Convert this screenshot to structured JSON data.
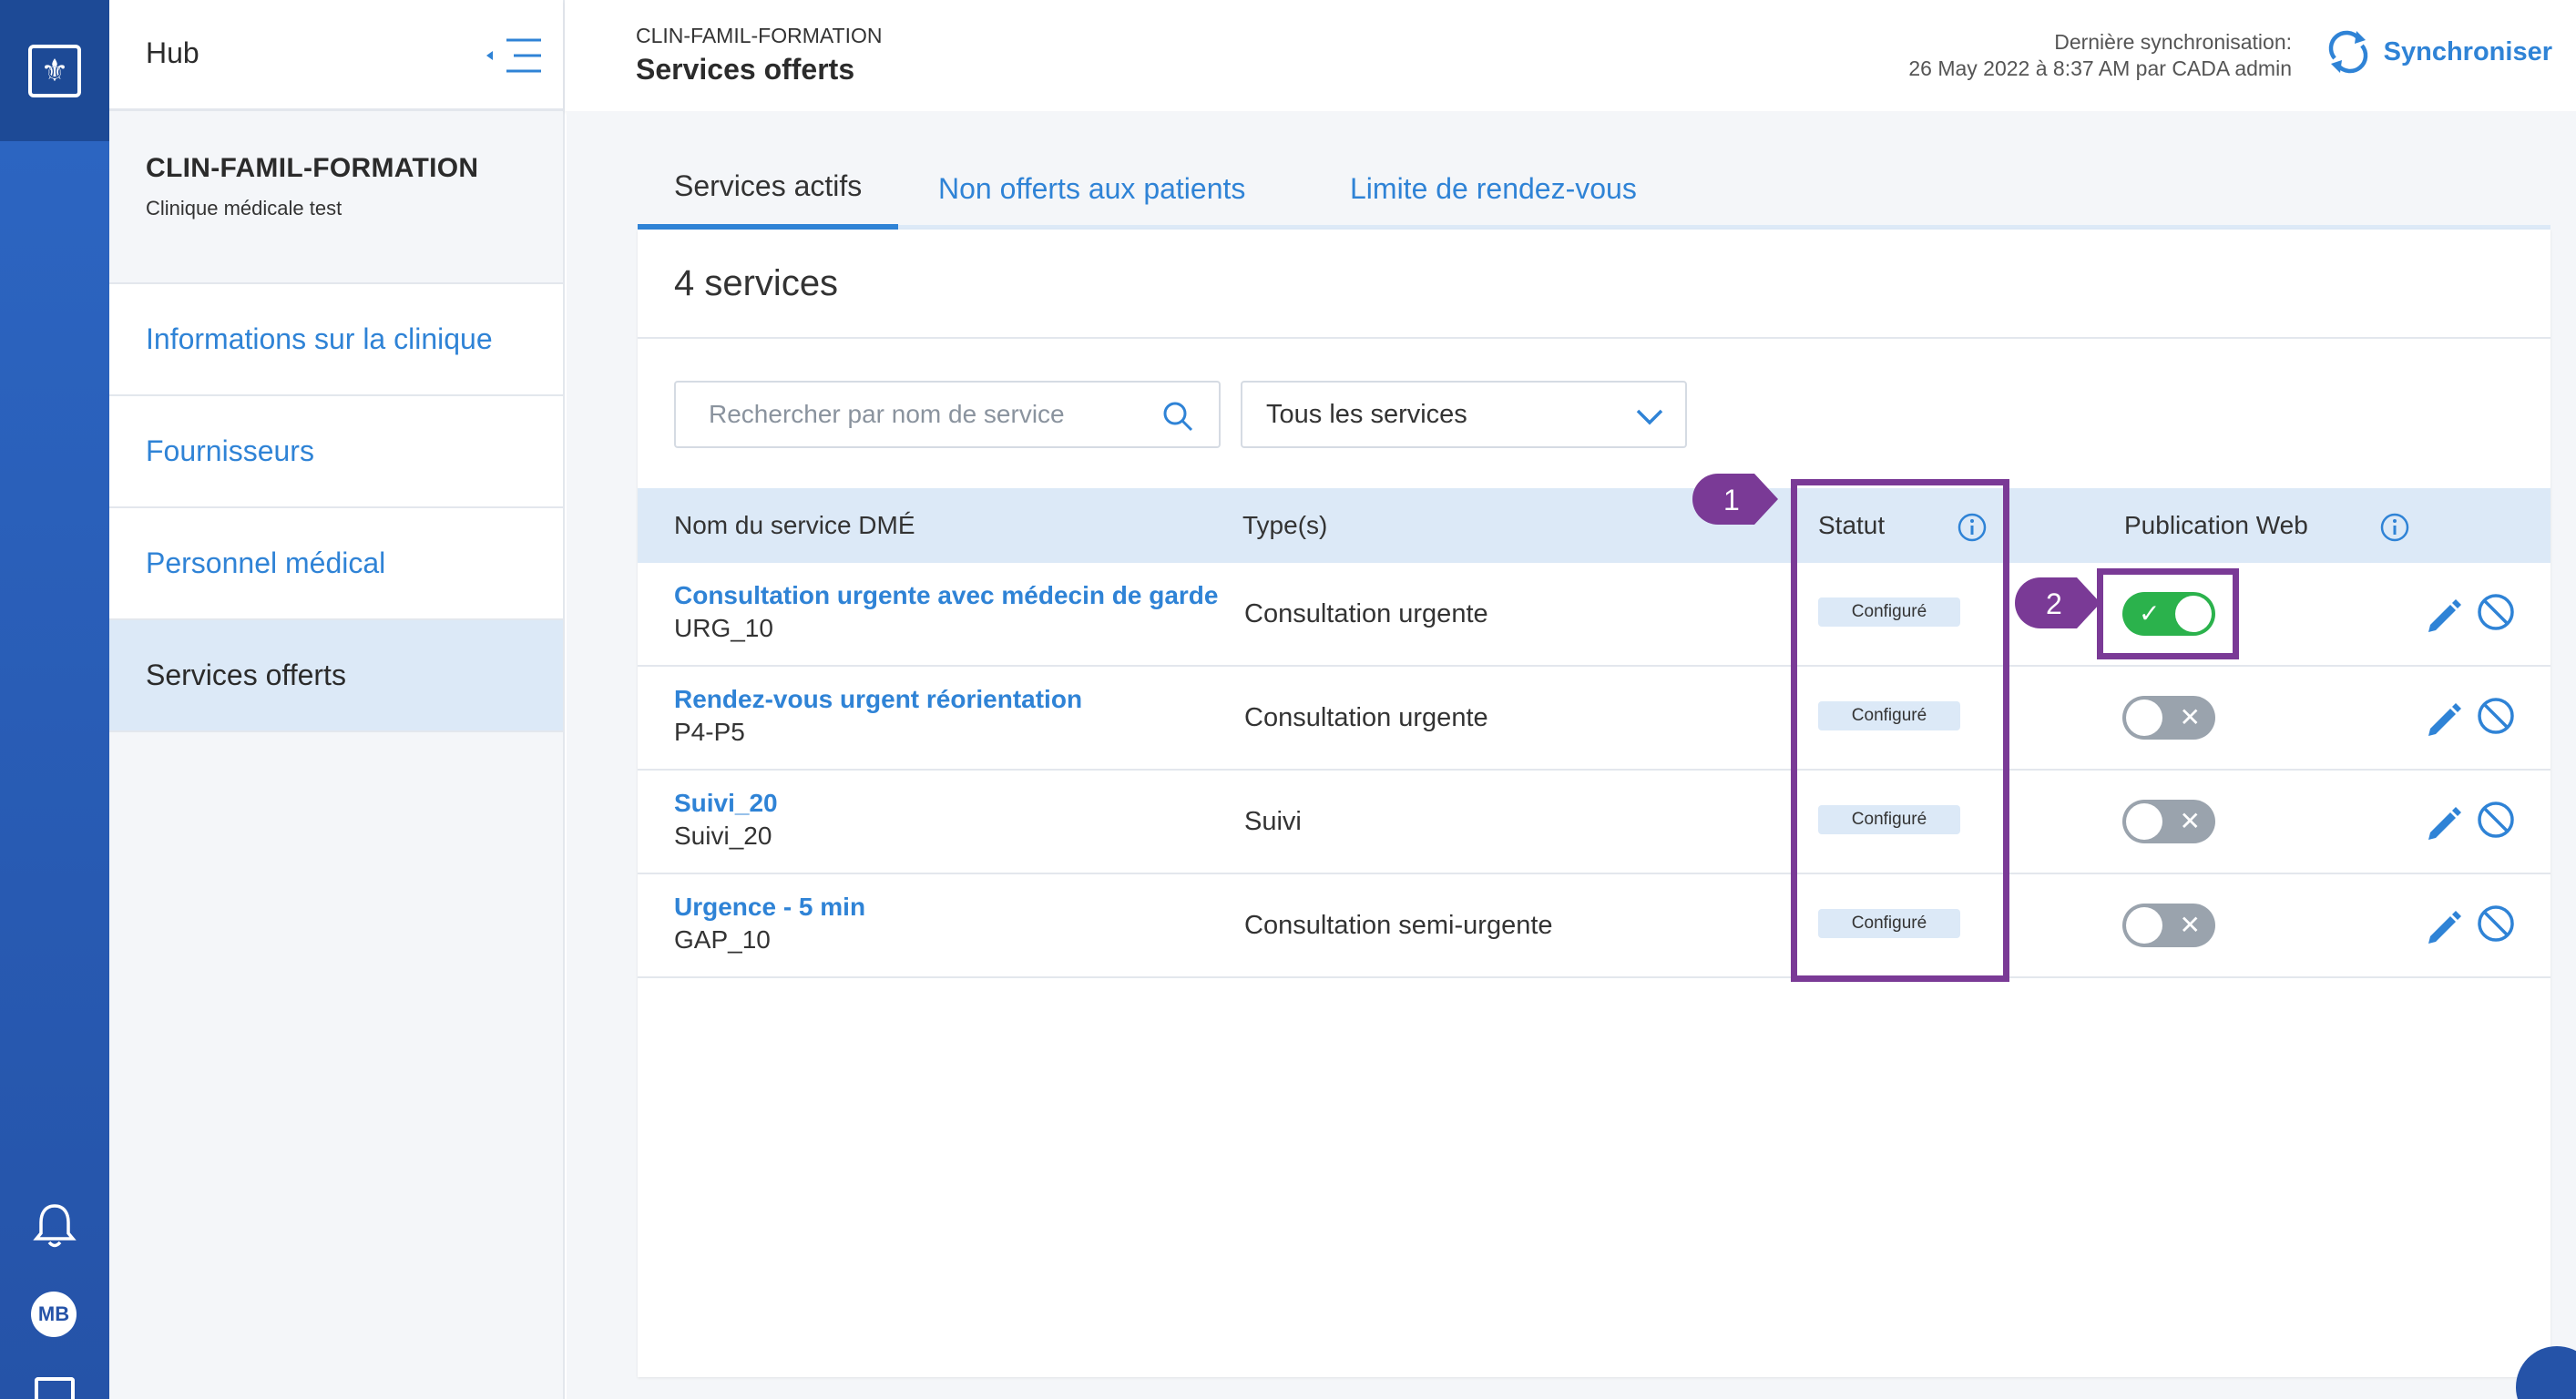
{
  "sidebar": {
    "hub_label": "Hub",
    "clinic_name": "CLIN-FAMIL-FORMATION",
    "clinic_subtitle": "Clinique médicale test",
    "items": [
      {
        "label": "Informations sur la clinique"
      },
      {
        "label": "Fournisseurs"
      },
      {
        "label": "Personnel médical"
      },
      {
        "label": "Services offerts"
      }
    ]
  },
  "rail": {
    "avatar_initials": "MB"
  },
  "header": {
    "breadcrumb": "CLIN-FAMIL-FORMATION",
    "title": "Services offerts",
    "sync_label": "Dernière synchronisation:",
    "sync_detail": "26 May 2022 à 8:37 AM par CADA admin",
    "sync_button": "Synchroniser"
  },
  "tabs": [
    {
      "label": "Services actifs"
    },
    {
      "label": "Non offerts aux patients"
    },
    {
      "label": "Limite de rendez-vous"
    }
  ],
  "card": {
    "count_label": "4 services"
  },
  "search": {
    "placeholder": "Rechercher par nom de service"
  },
  "filter": {
    "selected": "Tous les services"
  },
  "table": {
    "headers": {
      "name": "Nom du service DMÉ",
      "type": "Type(s)",
      "status": "Statut",
      "publication": "Publication Web"
    },
    "rows": [
      {
        "name": "Consultation urgente avec médecin de garde",
        "code": "URG_10",
        "type": "Consultation urgente",
        "status": "Configuré",
        "published": true
      },
      {
        "name": "Rendez-vous urgent réorientation",
        "code": "P4-P5",
        "type": "Consultation urgente",
        "status": "Configuré",
        "published": false
      },
      {
        "name": "Suivi_20",
        "code": "Suivi_20",
        "type": "Suivi",
        "status": "Configuré",
        "published": false
      },
      {
        "name": "Urgence - 5 min",
        "code": "GAP_10",
        "type": "Consultation semi-urgente",
        "status": "Configuré",
        "published": false
      }
    ]
  },
  "annotations": {
    "marker1": "1",
    "marker2": "2"
  },
  "colors": {
    "accent": "#2f83d6",
    "rail": "#2553a8",
    "toggle_on": "#2bb24c",
    "toggle_off": "#9aa3ad",
    "annotation": "#7a3a96"
  }
}
